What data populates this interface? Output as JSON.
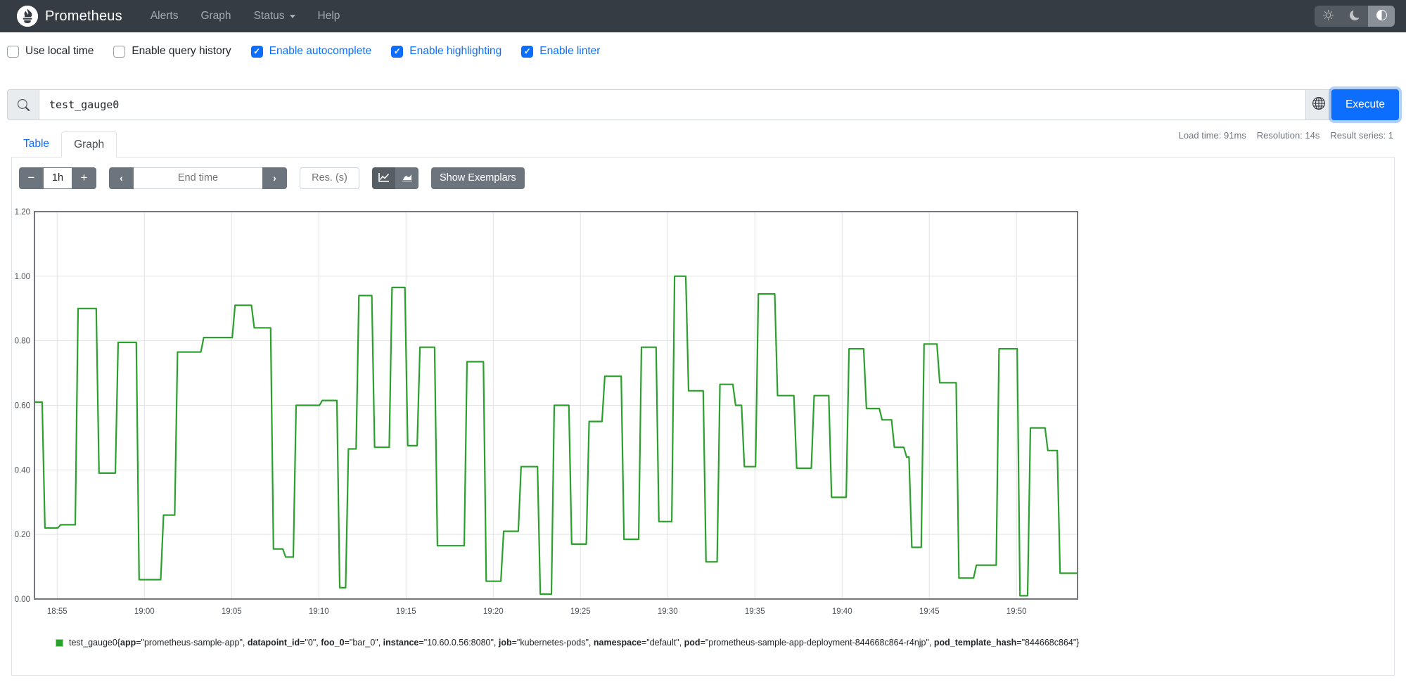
{
  "navbar": {
    "brand": "Prometheus",
    "items": [
      {
        "label": "Alerts"
      },
      {
        "label": "Graph"
      },
      {
        "label": "Status",
        "has_dropdown": true
      },
      {
        "label": "Help"
      }
    ],
    "theme_buttons": [
      {
        "icon": "sun-icon",
        "active": false
      },
      {
        "icon": "moon-icon",
        "active": false
      },
      {
        "icon": "contrast-icon",
        "active": true
      }
    ]
  },
  "options": [
    {
      "label": "Use local time",
      "checked": false
    },
    {
      "label": "Enable query history",
      "checked": false
    },
    {
      "label": "Enable autocomplete",
      "checked": true
    },
    {
      "label": "Enable highlighting",
      "checked": true
    },
    {
      "label": "Enable linter",
      "checked": true
    }
  ],
  "query": {
    "value": "test_gauge0",
    "execute_label": "Execute"
  },
  "stats": {
    "load_time": "Load time: 91ms",
    "resolution": "Resolution: 14s",
    "result_series": "Result series: 1"
  },
  "tabs": [
    {
      "label": "Table",
      "active": false
    },
    {
      "label": "Graph",
      "active": true
    }
  ],
  "graph_controls": {
    "minus": "−",
    "range": "1h",
    "plus": "+",
    "prev": "‹",
    "end_time_placeholder": "End time",
    "next": "›",
    "res_placeholder": "Res. (s)",
    "show_exemplars": "Show Exemplars"
  },
  "chart_data": {
    "type": "line",
    "subtype": "step-gauge",
    "series_name": "test_gauge0",
    "line_color": "#2ca02c",
    "grid": true,
    "legend_position": "bottom",
    "ylim": [
      0,
      1.2
    ],
    "y_ticks": [
      0,
      0.2,
      0.4,
      0.6,
      0.8,
      1.0,
      1.2
    ],
    "y_tick_labels": [
      "0.00",
      "0.20",
      "0.40",
      "0.60",
      "0.80",
      "1.00",
      "1.20"
    ],
    "x_tick_labels": [
      "18:55",
      "19:00",
      "19:05",
      "19:10",
      "19:15",
      "19:20",
      "19:25",
      "19:30",
      "19:35",
      "19:40",
      "19:45",
      "19:50"
    ],
    "x_minutes_range": [
      -1.3,
      58.5
    ],
    "tick_interval_minutes": 5,
    "points": [
      [
        -1.3,
        0.61
      ],
      [
        -0.7,
        0.22
      ],
      [
        0.2,
        0.23
      ],
      [
        1.2,
        0.9
      ],
      [
        2.4,
        0.39
      ],
      [
        3.5,
        0.795
      ],
      [
        4.7,
        0.06
      ],
      [
        6.1,
        0.26
      ],
      [
        6.9,
        0.765
      ],
      [
        8.4,
        0.81
      ],
      [
        10.2,
        0.91
      ],
      [
        11.3,
        0.84
      ],
      [
        12.4,
        0.155
      ],
      [
        13.1,
        0.13
      ],
      [
        13.7,
        0.6
      ],
      [
        15.2,
        0.615
      ],
      [
        16.2,
        0.035
      ],
      [
        16.7,
        0.465
      ],
      [
        17.3,
        0.94
      ],
      [
        18.2,
        0.47
      ],
      [
        19.2,
        0.965
      ],
      [
        20.1,
        0.475
      ],
      [
        20.8,
        0.78
      ],
      [
        21.8,
        0.165
      ],
      [
        23.5,
        0.735
      ],
      [
        24.6,
        0.055
      ],
      [
        25.6,
        0.21
      ],
      [
        26.6,
        0.41
      ],
      [
        27.7,
        0.015
      ],
      [
        28.5,
        0.6
      ],
      [
        29.5,
        0.17
      ],
      [
        30.5,
        0.55
      ],
      [
        31.4,
        0.69
      ],
      [
        32.5,
        0.185
      ],
      [
        33.5,
        0.78
      ],
      [
        34.5,
        0.24
      ],
      [
        35.4,
        1.0
      ],
      [
        36.2,
        0.645
      ],
      [
        37.2,
        0.115
      ],
      [
        38.0,
        0.665
      ],
      [
        38.9,
        0.6
      ],
      [
        39.4,
        0.41
      ],
      [
        40.2,
        0.945
      ],
      [
        41.3,
        0.63
      ],
      [
        42.4,
        0.405
      ],
      [
        43.4,
        0.63
      ],
      [
        44.4,
        0.315
      ],
      [
        45.4,
        0.775
      ],
      [
        46.4,
        0.59
      ],
      [
        47.3,
        0.555
      ],
      [
        48.0,
        0.47
      ],
      [
        48.7,
        0.44
      ],
      [
        49.0,
        0.16
      ],
      [
        49.7,
        0.79
      ],
      [
        50.6,
        0.67
      ],
      [
        51.7,
        0.065
      ],
      [
        52.7,
        0.105
      ],
      [
        54.0,
        0.775
      ],
      [
        55.2,
        0.01
      ],
      [
        55.8,
        0.53
      ],
      [
        56.8,
        0.46
      ],
      [
        57.5,
        0.08
      ],
      [
        58.5,
        0.08
      ]
    ]
  },
  "legend": {
    "series": "test_gauge0",
    "labels": [
      {
        "name": "app",
        "value": "prometheus-sample-app"
      },
      {
        "name": "datapoint_id",
        "value": "0"
      },
      {
        "name": "foo_0",
        "value": "bar_0"
      },
      {
        "name": "instance",
        "value": "10.60.0.56:8080"
      },
      {
        "name": "job",
        "value": "kubernetes-pods"
      },
      {
        "name": "namespace",
        "value": "default"
      },
      {
        "name": "pod",
        "value": "prometheus-sample-app-deployment-844668c864-r4njp"
      },
      {
        "name": "pod_template_hash",
        "value": "844668c864"
      }
    ]
  }
}
